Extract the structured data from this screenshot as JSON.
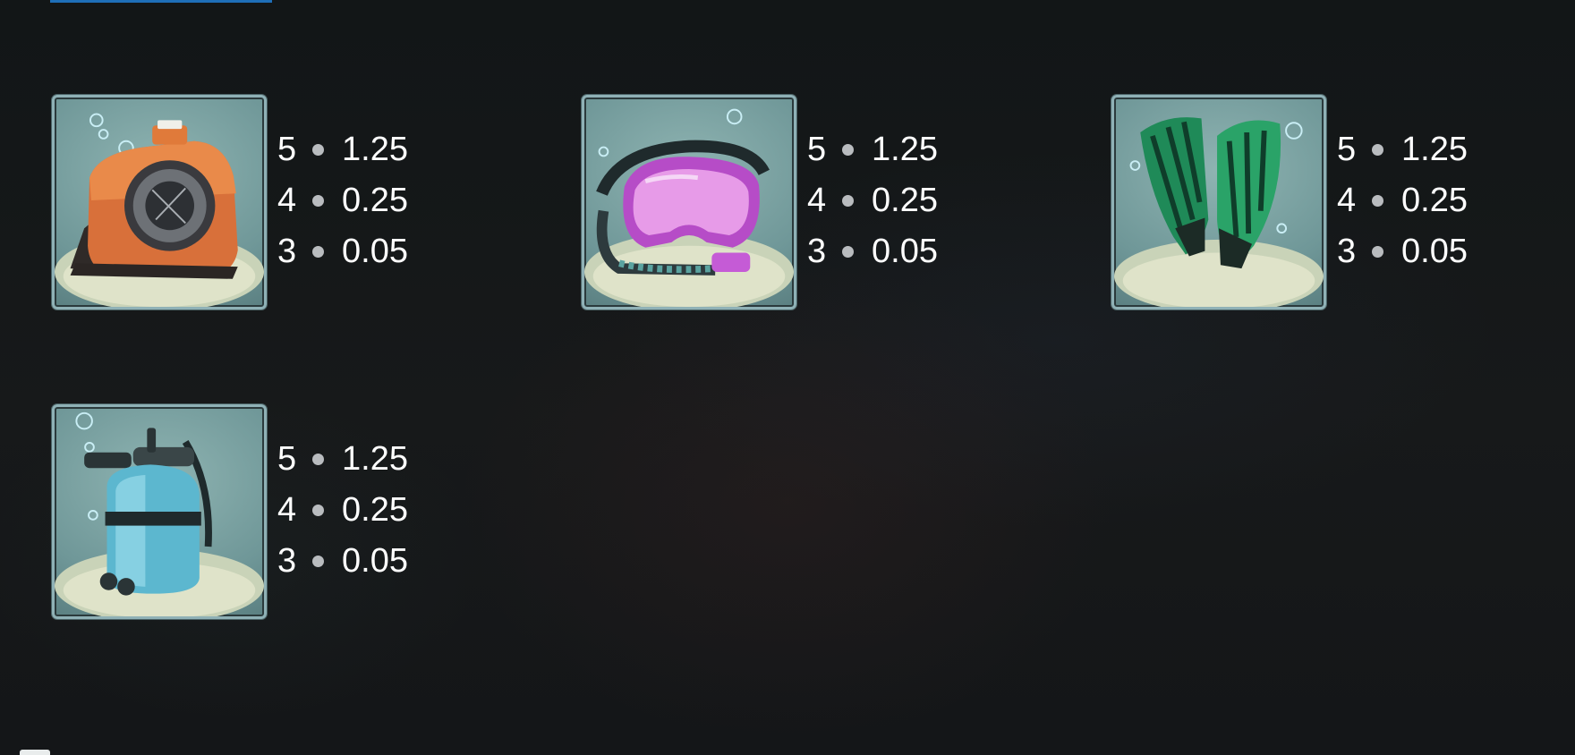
{
  "symbols": [
    {
      "name": "camera",
      "icon": "underwater-camera-icon",
      "pays": [
        {
          "count": "5",
          "value": "1.25"
        },
        {
          "count": "4",
          "value": "0.25"
        },
        {
          "count": "3",
          "value": "0.05"
        }
      ]
    },
    {
      "name": "mask",
      "icon": "diving-mask-icon",
      "pays": [
        {
          "count": "5",
          "value": "1.25"
        },
        {
          "count": "4",
          "value": "0.25"
        },
        {
          "count": "3",
          "value": "0.05"
        }
      ]
    },
    {
      "name": "flippers",
      "icon": "flippers-icon",
      "pays": [
        {
          "count": "5",
          "value": "1.25"
        },
        {
          "count": "4",
          "value": "0.25"
        },
        {
          "count": "3",
          "value": "0.05"
        }
      ]
    },
    {
      "name": "tank",
      "icon": "oxygen-tank-icon",
      "pays": [
        {
          "count": "5",
          "value": "1.25"
        },
        {
          "count": "4",
          "value": "0.25"
        },
        {
          "count": "3",
          "value": "0.05"
        }
      ]
    }
  ],
  "colors": {
    "tile_border": "#8fb1b6",
    "text": "#ffffff",
    "bullet": "#b9bcbf",
    "camera": "#e07a3a",
    "mask": "#d36ee0",
    "flippers": "#2fa36a",
    "tank": "#5cb7cf"
  }
}
